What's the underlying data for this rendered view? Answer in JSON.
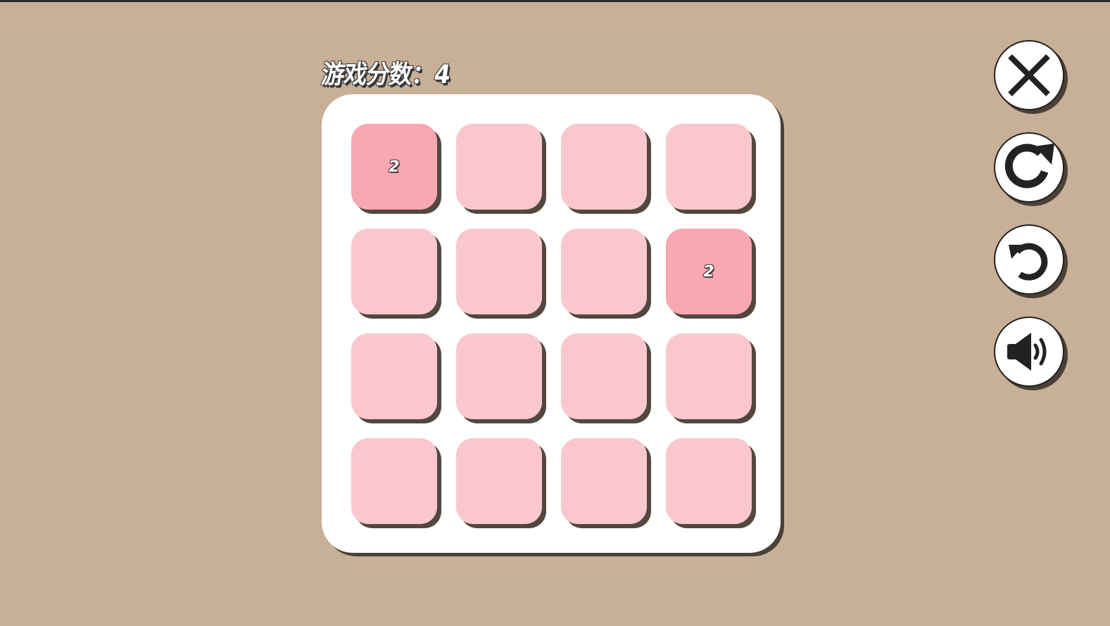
{
  "score": {
    "text": "游戏分数：4"
  },
  "board": {
    "rows": [
      [
        "2",
        "",
        "",
        ""
      ],
      [
        "",
        "",
        "",
        "2"
      ],
      [
        "",
        "",
        "",
        ""
      ],
      [
        "",
        "",
        "",
        ""
      ]
    ]
  },
  "controls": [
    {
      "name": "close-button",
      "icon": "close-icon"
    },
    {
      "name": "restart-button",
      "icon": "redo-icon"
    },
    {
      "name": "undo-button",
      "icon": "undo-icon"
    },
    {
      "name": "sound-button",
      "icon": "speaker-icon"
    }
  ],
  "colors": {
    "background": "#c8af98",
    "board": "#ffffff",
    "empty_tile": "#fac8cc",
    "tile_2": "#f9a7b0"
  }
}
